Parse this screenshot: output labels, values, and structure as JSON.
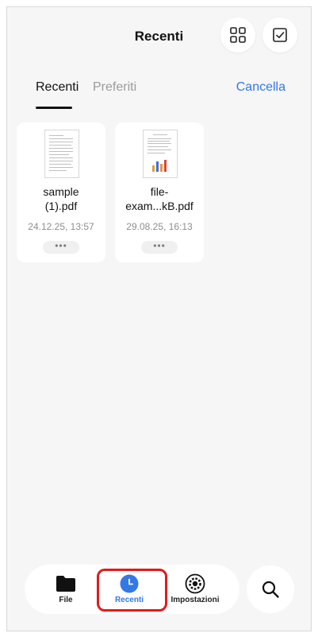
{
  "header": {
    "title": "Recenti",
    "grid_view_icon": "grid-icon",
    "select_icon": "checkbox-icon"
  },
  "tabs": [
    {
      "label": "Recenti",
      "active": true
    },
    {
      "label": "Preferiti",
      "active": false
    }
  ],
  "cancel_label": "Cancella",
  "files": [
    {
      "name_line1": "sample",
      "name_line2": "(1).pdf",
      "date": "24.12.25, 13:57",
      "more": "•••"
    },
    {
      "name_line1": "file-",
      "name_line2": "exam...kB.pdf",
      "date": "29.08.25, 16:13",
      "more": "•••"
    }
  ],
  "bottom_nav": [
    {
      "label": "File",
      "icon": "folder-icon",
      "active": false
    },
    {
      "label": "Recenti",
      "icon": "clock-icon",
      "active": true
    },
    {
      "label": "Impostazioni",
      "icon": "settings-gear-icon",
      "active": false
    }
  ],
  "search_icon": "search-icon",
  "colors": {
    "accent": "#3478e6",
    "highlight": "#e21b1b",
    "background": "#f6f6f6"
  }
}
